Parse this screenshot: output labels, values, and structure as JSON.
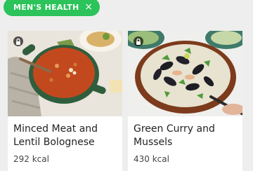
{
  "filter": {
    "chip_label": "MEN'S HEALTH",
    "close_glyph": "×",
    "color": "#2bc35a"
  },
  "recipes": [
    {
      "title": "Minced Meat and Lentil Bolognese",
      "kcal": "292 kcal",
      "icon": "lock-icon"
    },
    {
      "title": "Green Curry and Mussels",
      "kcal": "430 kcal",
      "icon": "lock-icon"
    }
  ]
}
